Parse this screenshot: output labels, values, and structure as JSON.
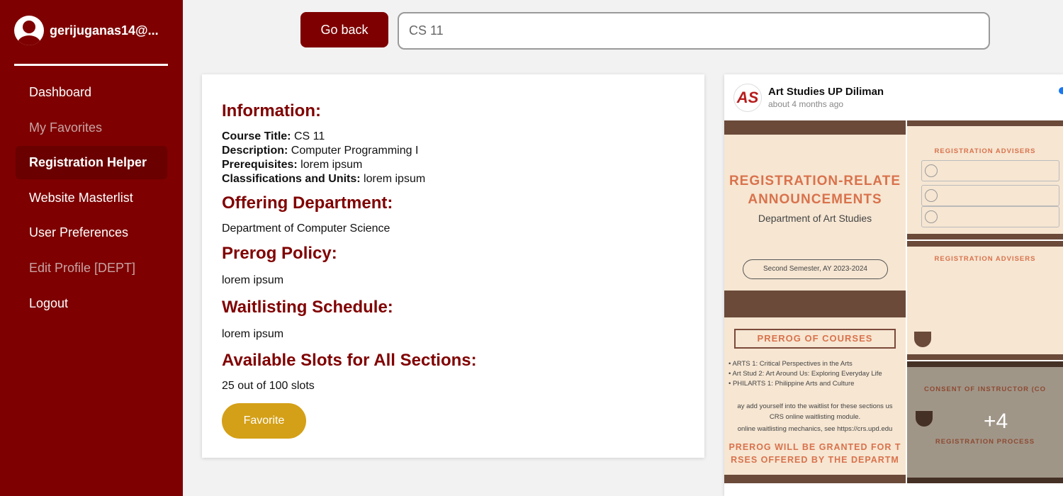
{
  "sidebar": {
    "user_name": "gerijuganas14@...",
    "items": [
      {
        "label": "Dashboard",
        "state": "normal"
      },
      {
        "label": "My Favorites",
        "state": "dim"
      },
      {
        "label": "Registration Helper",
        "state": "active"
      },
      {
        "label": "Website Masterlist",
        "state": "normal"
      },
      {
        "label": "User Preferences",
        "state": "normal"
      },
      {
        "label": "Edit Profile [DEPT]",
        "state": "dim"
      },
      {
        "label": "Logout",
        "state": "normal"
      }
    ]
  },
  "toolbar": {
    "back_label": "Go back",
    "search_value": "CS 11"
  },
  "info": {
    "heading": "Information:",
    "course_title_label": "Course Title:",
    "course_title_value": " CS 11",
    "description_label": "Description:",
    "description_value": " Computer Programming I",
    "prerequisites_label": "Prerequisites:",
    "prerequisites_value": " lorem ipsum",
    "classifications_label": "Classifications and Units:",
    "classifications_value": " lorem ipsum",
    "offering_heading": "Offering Department:",
    "offering_value": "Department of Computer Science",
    "prerog_heading": "Prerog Policy:",
    "prerog_value": "lorem ipsum",
    "waitlist_heading": "Waitlisting Schedule:",
    "waitlist_value": "lorem ipsum",
    "slots_heading": "Available Slots for All Sections:",
    "slots_value": "25 out of 100 slots",
    "favorite_label": "Favorite"
  },
  "post": {
    "page_name": "Art Studies UP Diliman",
    "time": "about 4 months ago",
    "logo_text": "AS",
    "image": {
      "title_line1": "REGISTRATION-RELATE",
      "title_line2": "ANNOUNCEMENTS",
      "dept": "Department of Art Studies",
      "semester": "Second Semester, AY 2023-2024",
      "prerog_title": "PREROG OF COURSES",
      "course1": "• ARTS 1: Critical Perspectives in the Arts",
      "course2": "• Art Stud 2: Art Around Us: Exploring Everyday Life",
      "course3": "• PHILARTS 1: Philippine Arts and Culture",
      "waitlist_line1": "ay add yourself into the waitlist for these sections us",
      "waitlist_line2": "CRS online waitlisting module.",
      "waitlist_line3": "online waitlisting mechanics, see https://crs.upd.edu",
      "granted_line1": "PREROG WILL BE GRANTED FOR T",
      "granted_line2": "RSES OFFERED BY THE DEPARTM"
    },
    "tiles": {
      "tile1_heading": "REGISTRATION ADVISERS",
      "tile2_heading": "REGISTRATION ADVISERS",
      "tile3_heading": "CONSENT OF INSTRUCTOR (CO",
      "tile3_sub": "REGISTRATION PROCESS",
      "more_count": "+4"
    }
  }
}
